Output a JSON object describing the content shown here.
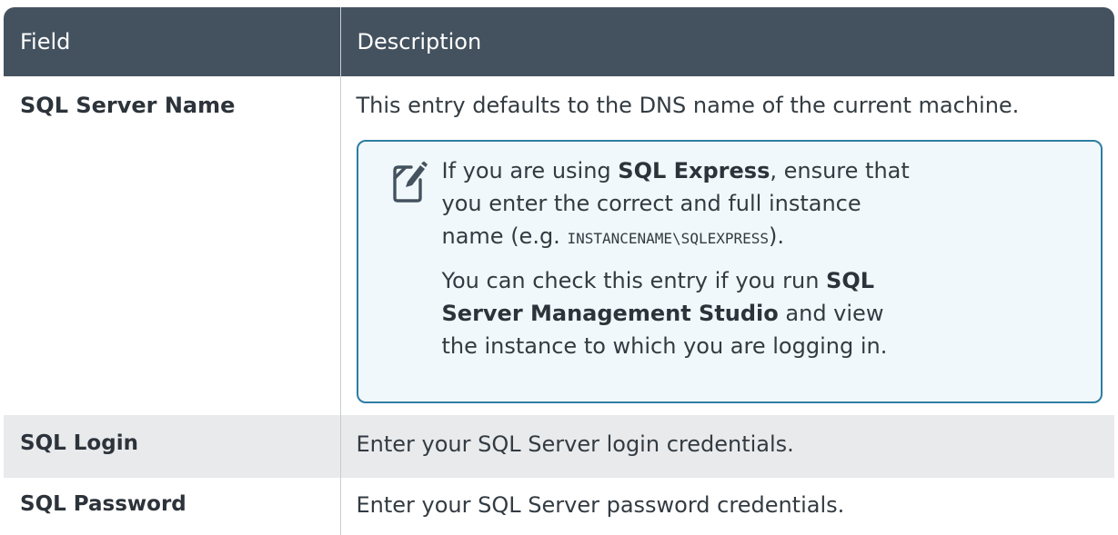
{
  "header": {
    "field": "Field",
    "description": "Description"
  },
  "rows": [
    {
      "field": "SQL Server Name",
      "description": "This entry defaults to the DNS name of the current machine.",
      "note": {
        "icon": "note-edit-icon",
        "p1_prefix": "If you are using ",
        "p1_bold": "SQL Express",
        "p1_mid": ", ensure that you enter the correct and full instance name (e.g. ",
        "p1_code": "INSTANCENAME\\SQLEXPRESS",
        "p1_suffix": ").",
        "p2_prefix": "You can check this entry if you run ",
        "p2_bold": "SQL Server Management Studio",
        "p2_suffix": " and view the instance to which you are logging in."
      }
    },
    {
      "field": "SQL Login",
      "description": "Enter your SQL Server login credentials."
    },
    {
      "field": "SQL Password",
      "description": "Enter your SQL Server password credentials."
    }
  ],
  "colors": {
    "header_bg": "#44525f",
    "note_border": "#2e7ea3",
    "note_bg": "#f1f8fb",
    "alt_row_bg": "#e8eaec"
  }
}
